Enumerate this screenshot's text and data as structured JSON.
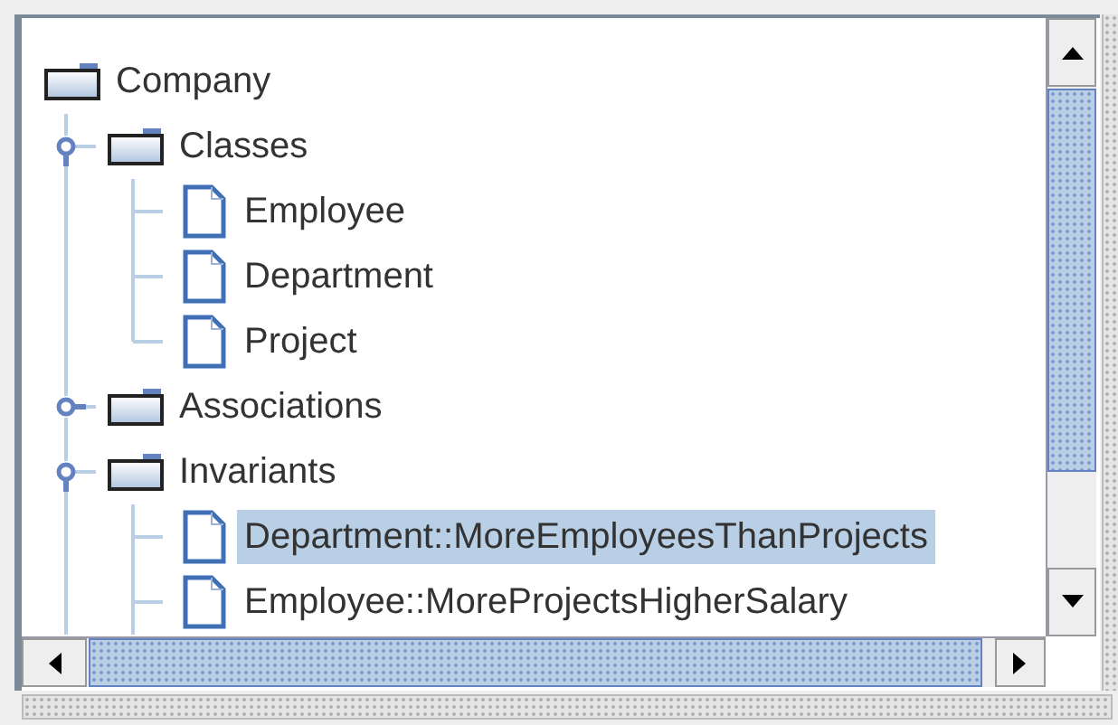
{
  "tree": {
    "label": "Company",
    "selected": false,
    "children": [
      {
        "label": "Classes",
        "selected": false,
        "expanded": true,
        "children": [
          {
            "label": "Employee",
            "selected": false
          },
          {
            "label": "Department",
            "selected": false
          },
          {
            "label": "Project",
            "selected": false
          }
        ]
      },
      {
        "label": "Associations",
        "selected": false,
        "expanded": false
      },
      {
        "label": "Invariants",
        "selected": false,
        "expanded": true,
        "children": [
          {
            "label": "Department::MoreEmployeesThanProjects",
            "selected": true
          },
          {
            "label": "Employee::MoreProjectsHigherSalary",
            "selected": false
          }
        ]
      }
    ]
  }
}
